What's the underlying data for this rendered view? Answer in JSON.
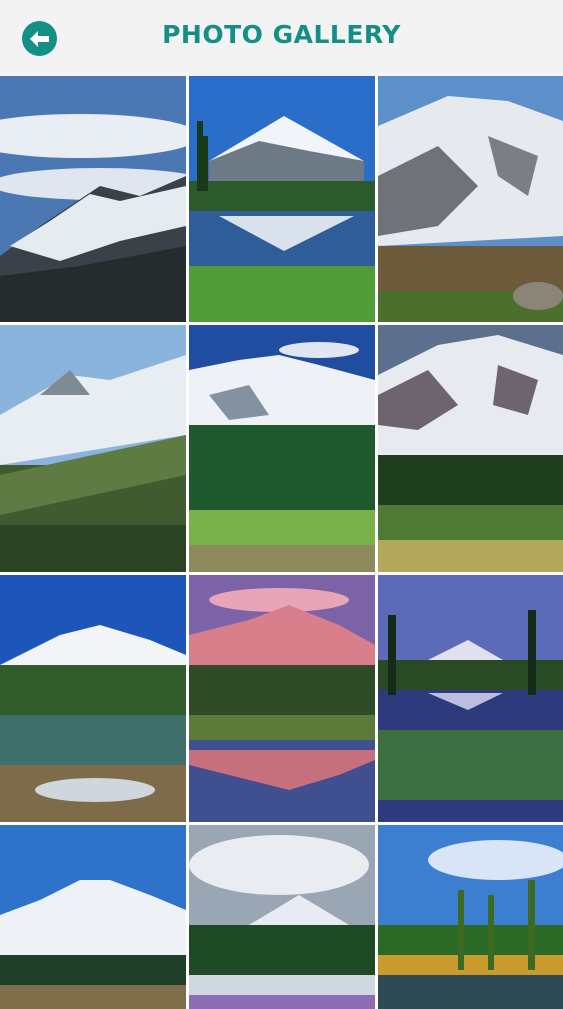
{
  "header": {
    "title": "PHOTO GALLERY",
    "back_icon": "arrow-left-icon"
  },
  "colors": {
    "accent": "#138f86",
    "header_bg": "#f3f3f3"
  }
}
